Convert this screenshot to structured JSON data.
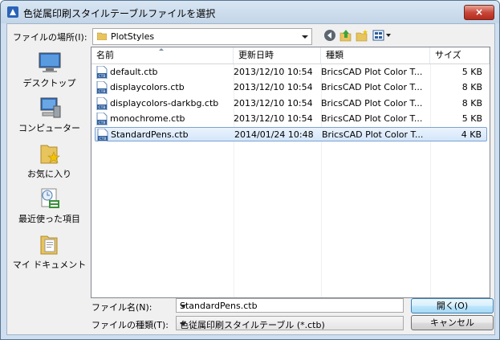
{
  "window": {
    "title": "色従属印刷スタイルテーブルファイルを選択",
    "close_label": "×"
  },
  "toolbar": {
    "look_in_label": "ファイルの場所(I):",
    "look_in_value": "PlotStyles",
    "icons": [
      "back-icon",
      "up-folder-icon",
      "new-folder-icon",
      "view-menu-icon"
    ]
  },
  "places": [
    {
      "label": "デスクトップ",
      "icon": "desktop-icon"
    },
    {
      "label": "コンピューター",
      "icon": "computer-icon"
    },
    {
      "label": "お気に入り",
      "icon": "favorites-icon"
    },
    {
      "label": "最近使った項目",
      "icon": "recent-items-icon"
    },
    {
      "label": "マイ ドキュメント",
      "icon": "my-documents-icon"
    }
  ],
  "columns": [
    "名前",
    "更新日時",
    "種類",
    "サイズ"
  ],
  "files": [
    {
      "name": "default.ctb",
      "date": "2013/12/10 10:54",
      "type": "BricsCAD Plot Color T...",
      "size": "5 KB"
    },
    {
      "name": "displaycolors.ctb",
      "date": "2013/12/10 10:54",
      "type": "BricsCAD Plot Color T...",
      "size": "8 KB"
    },
    {
      "name": "displaycolors-darkbg.ctb",
      "date": "2013/12/10 10:54",
      "type": "BricsCAD Plot Color T...",
      "size": "8 KB"
    },
    {
      "name": "monochrome.ctb",
      "date": "2013/12/10 10:54",
      "type": "BricsCAD Plot Color T...",
      "size": "5 KB"
    },
    {
      "name": "StandardPens.ctb",
      "date": "2014/01/24 10:48",
      "type": "BricsCAD Plot Color T...",
      "size": "4 KB",
      "selected": true
    }
  ],
  "form": {
    "filename_label": "ファイル名(N):",
    "filename_value": "StandardPens.ctb",
    "filetype_label": "ファイルの種類(T):",
    "filetype_value": "色従属印刷スタイルテーブル (*.ctb)",
    "open_label": "開く(O)",
    "cancel_label": "キャンセル"
  },
  "colors": {
    "accent": "#3399ff",
    "selection": "#d4e6fb",
    "titlebar": "#c3d5e8"
  }
}
